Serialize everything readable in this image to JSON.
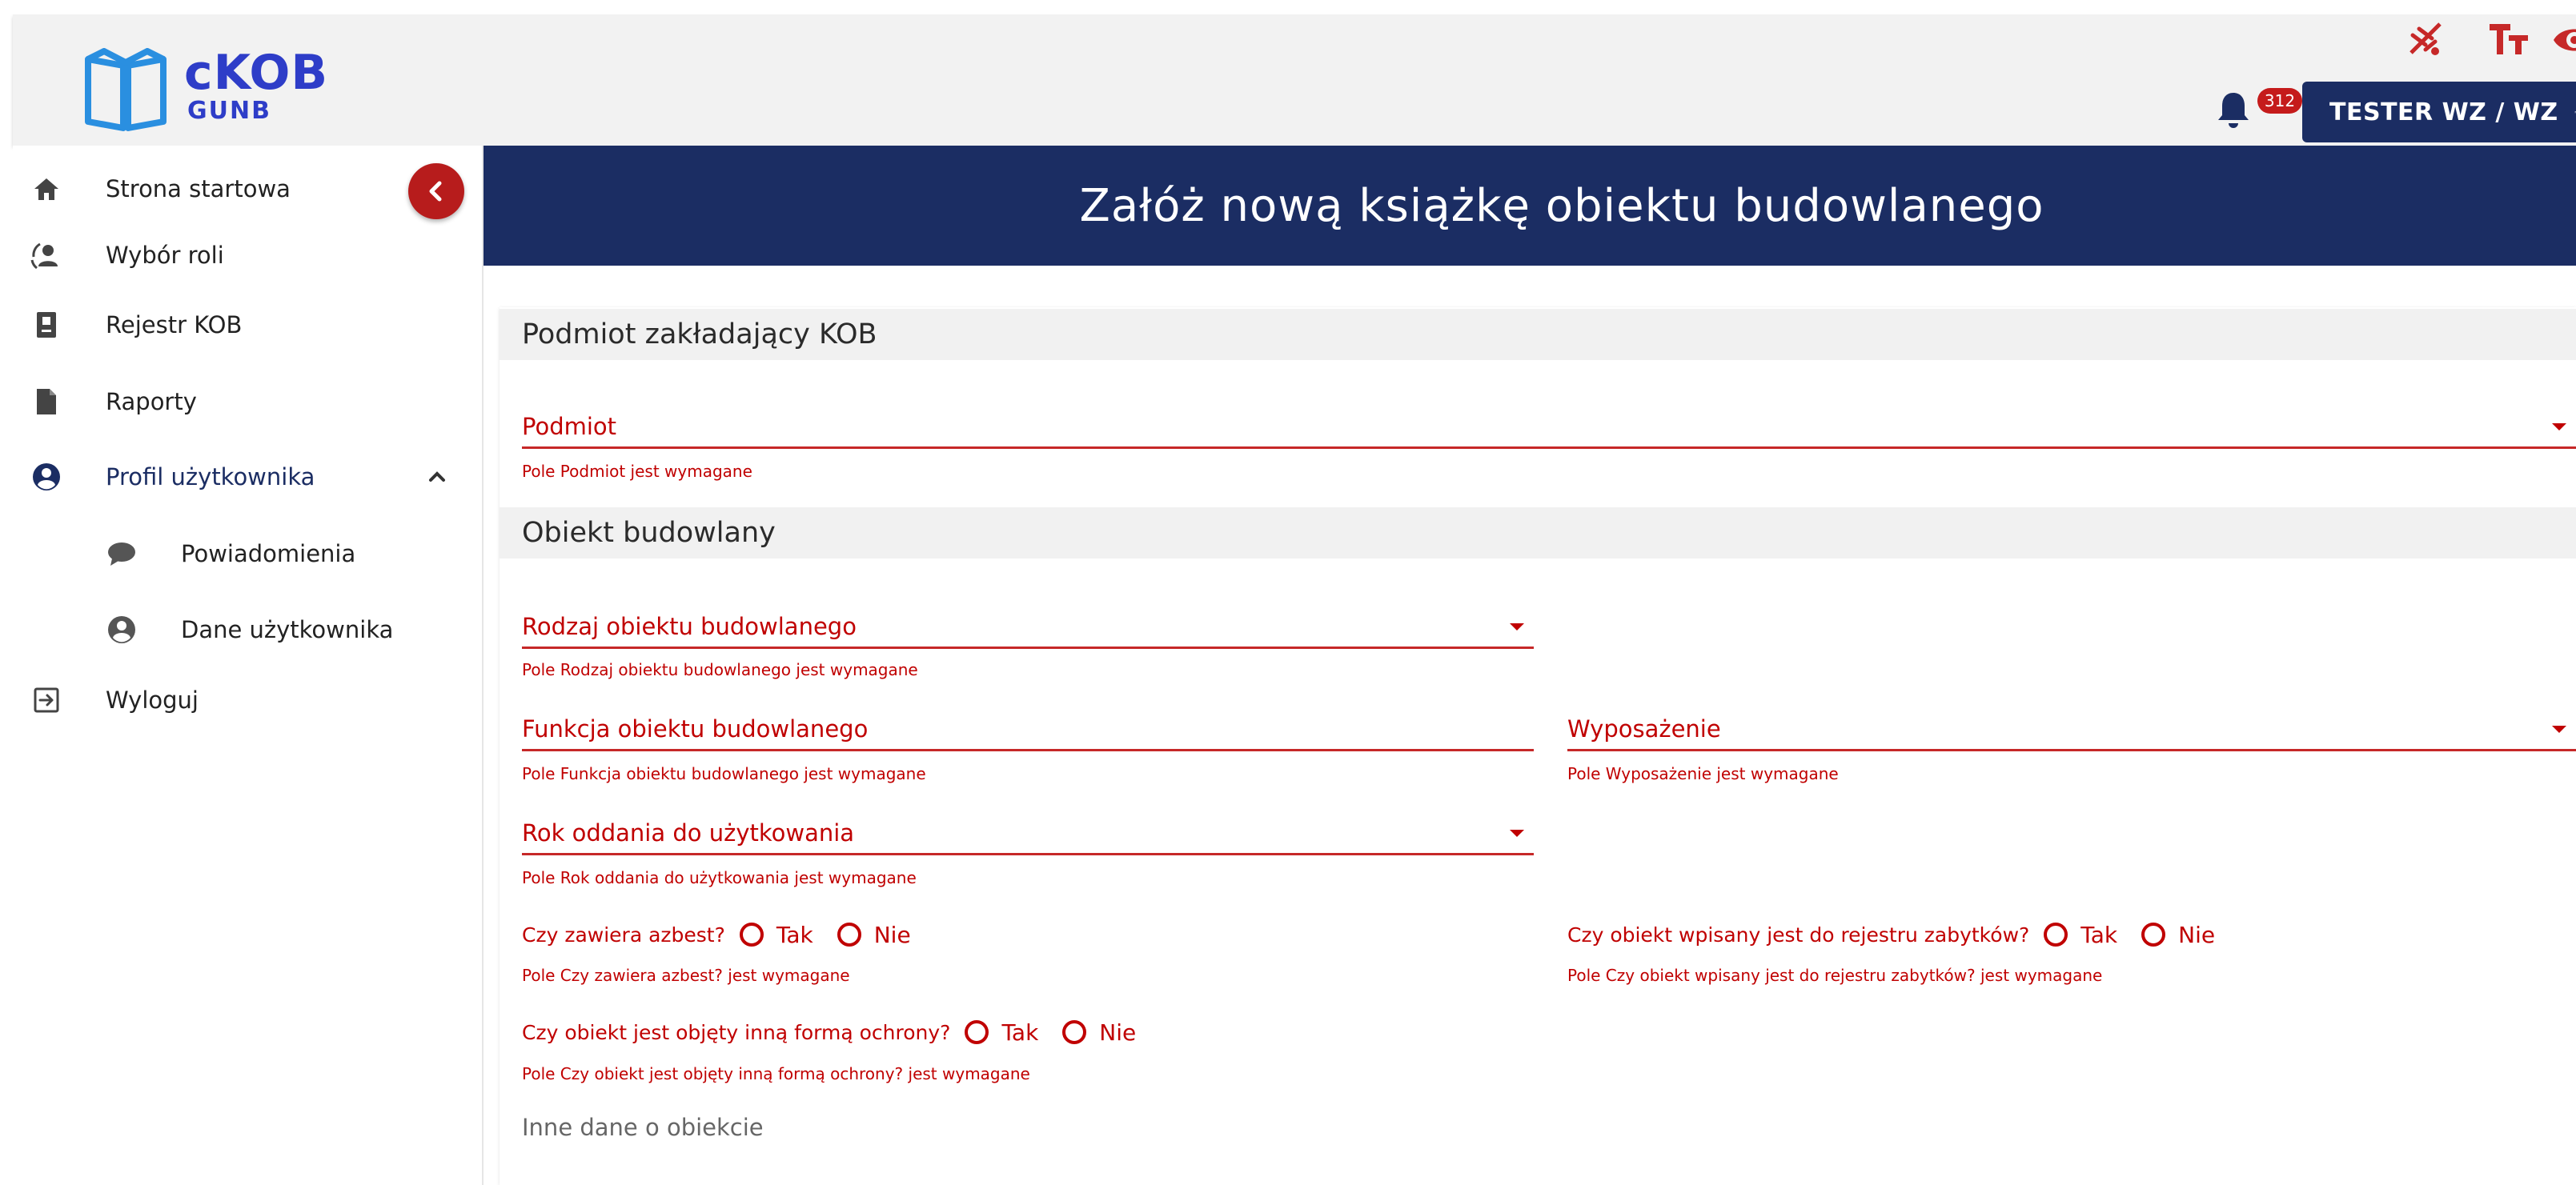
{
  "app": {
    "logo_title": "cKOB",
    "logo_sub": "GUNB"
  },
  "header": {
    "tool_icons": [
      "no-animation-icon",
      "font-size-icon",
      "contrast-eye-icon"
    ],
    "notifications_count": "312",
    "user_label": "TESTER WZ / WZ"
  },
  "sidebar": {
    "items": [
      {
        "label": "Strona startowa",
        "icon": "home-icon"
      },
      {
        "label": "Wybór roli",
        "icon": "role-switch-icon"
      },
      {
        "label": "Rejestr KOB",
        "icon": "register-book-icon"
      },
      {
        "label": "Raporty",
        "icon": "document-icon"
      },
      {
        "label": "Profil użytkownika",
        "icon": "account-circle-icon"
      },
      {
        "label": "Powiadomienia",
        "icon": "chat-bubble-icon"
      },
      {
        "label": "Dane użytkownika",
        "icon": "account-circle-icon"
      },
      {
        "label": "Wyloguj",
        "icon": "logout-icon"
      }
    ]
  },
  "page": {
    "title": "Załóż nową książkę obiektu budowlanego"
  },
  "form": {
    "section1": {
      "title": "Podmiot zakładający KOB",
      "podmiot_label": "Podmiot",
      "podmiot_error": "Pole Podmiot jest wymagane"
    },
    "section2": {
      "title": "Obiekt budowlany",
      "rodzaj_label": "Rodzaj obiektu budowlanego",
      "rodzaj_error": "Pole Rodzaj obiektu budowlanego jest wymagane",
      "funkcja_label": "Funkcja obiektu budowlanego",
      "funkcja_error": "Pole Funkcja obiektu budowlanego jest wymagane",
      "wyposazenie_label": "Wyposażenie",
      "wyposazenie_error": "Pole Wyposażenie jest wymagane",
      "rok_label": "Rok oddania do użytkowania",
      "rok_error": "Pole Rok oddania do użytkowania jest wymagane",
      "azbest_q": "Czy zawiera azbest?",
      "azbest_error": "Pole Czy zawiera azbest? jest wymagane",
      "zabytki_q": "Czy obiekt wpisany jest do rejestru zabytków?",
      "zabytki_error": "Pole Czy obiekt wpisany jest do rejestru zabytków? jest wymagane",
      "ochrona_q": "Czy obiekt jest objęty inną formą ochrony?",
      "ochrona_error": "Pole Czy obiekt jest objęty inną formą ochrony? jest wymagane",
      "option_yes": "Tak",
      "option_no": "Nie",
      "other_data": "Inne dane o obiekcie"
    }
  },
  "colors": {
    "navy": "#1b2d63",
    "error_red": "#c00000",
    "brand_blue": "#2e3dc8",
    "badge_red": "#c51b1b"
  }
}
